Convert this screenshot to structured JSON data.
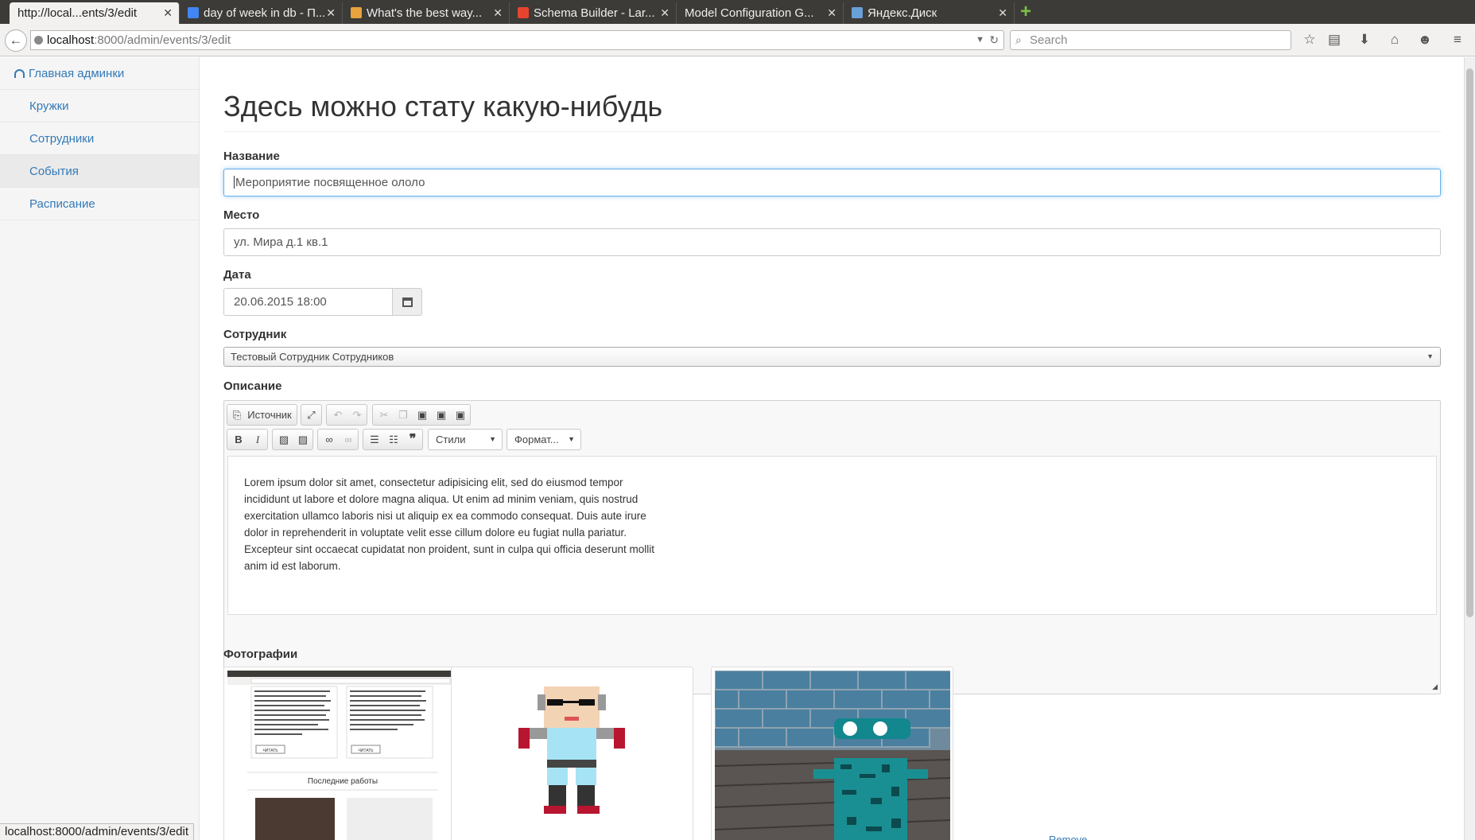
{
  "browser": {
    "tabs": [
      {
        "label": "http://local...ents/3/edit"
      },
      {
        "label": "day of week in db - П..."
      },
      {
        "label": "What's the best way..."
      },
      {
        "label": "Schema Builder - Lar..."
      },
      {
        "label": "Model Configuration G..."
      },
      {
        "label": "Яндекс.Диск"
      }
    ],
    "url_host": "localhost",
    "url_path": ":8000/admin/events/3/edit",
    "search_placeholder": "Search",
    "status_url": "localhost:8000/admin/events/3/edit"
  },
  "sidebar": {
    "home": "Главная админки",
    "items": [
      {
        "label": "Кружки"
      },
      {
        "label": "Сотрудники"
      },
      {
        "label": "События"
      },
      {
        "label": "Расписание"
      }
    ]
  },
  "page": {
    "title": "Здесь можно стату какую-нибудь",
    "name_label": "Название",
    "name_value": "Мероприятие посвященное ололо",
    "place_label": "Место",
    "place_value": "ул. Мира д.1 кв.1",
    "date_label": "Дата",
    "date_value": "20.06.2015 18:00",
    "employee_label": "Сотрудник",
    "employee_value": "Тестовый Сотрудник Сотрудников",
    "description_label": "Описание",
    "photos_label": "Фотографии",
    "remove_label": "Remove"
  },
  "editor": {
    "source_label": "Источник",
    "styles_label": "Стили",
    "format_label": "Формат...",
    "content": "Lorem ipsum dolor sit amet, consectetur adipisicing elit, sed do eiusmod tempor incididunt ut labore et dolore magna aliqua. Ut enim ad minim veniam, quis nostrud exercitation ullamco laboris nisi ut aliquip ex ea commodo consequat. Duis aute irure dolor in reprehenderit in voluptate velit esse cillum dolore eu fugiat nulla pariatur. Excepteur sint occaecat cupidatat non proident, sunt in culpa qui officia deserunt mollit anim id est laborum."
  },
  "thumbnail": {
    "section_title": "Последние работы",
    "button_label": "ЧИТАТЬ"
  },
  "colors": {
    "link": "#337ab7",
    "focus": "#66afe9"
  }
}
